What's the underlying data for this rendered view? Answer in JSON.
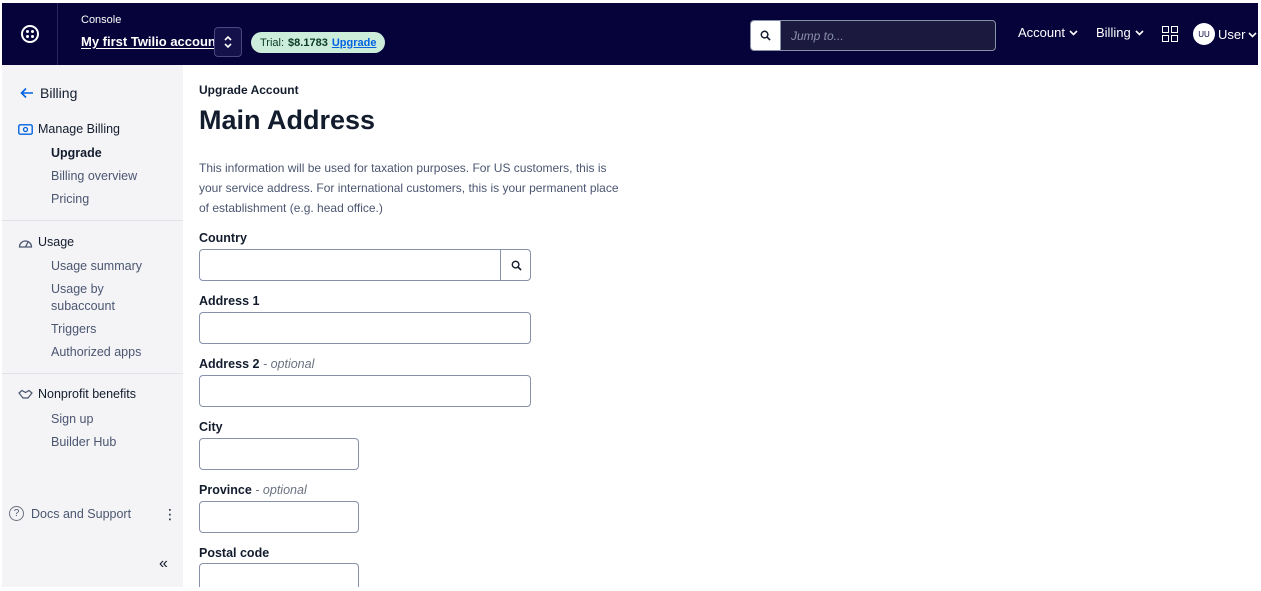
{
  "header": {
    "console_label": "Console",
    "account_name": "My first Twilio account",
    "trial_label": "Trial:",
    "trial_balance": "$8.1783",
    "upgrade_link": "Upgrade",
    "search_placeholder": "Jump to...",
    "account_menu": "Account",
    "billing_menu": "Billing",
    "avatar_initials": "UU",
    "user_label": "User"
  },
  "sidebar": {
    "back_label": "Billing",
    "sections": [
      {
        "title": "Manage Billing",
        "items": [
          "Upgrade",
          "Billing overview",
          "Pricing"
        ]
      },
      {
        "title": "Usage",
        "items": [
          "Usage summary",
          "Usage by",
          "subaccount",
          "Triggers",
          "Authorized apps"
        ]
      },
      {
        "title": "Nonprofit benefits",
        "items": [
          "Sign up",
          "Builder Hub"
        ]
      }
    ],
    "docs_label": "Docs and Support"
  },
  "main": {
    "breadcrumb": "Upgrade Account",
    "title": "Main Address",
    "description": "This information will be used for taxation purposes. For US customers, this is your service address. For international customers, this is your permanent place of establishment (e.g. head office.)",
    "fields": {
      "country": {
        "label": "Country",
        "value": ""
      },
      "address1": {
        "label": "Address 1",
        "value": ""
      },
      "address2": {
        "label": "Address 2",
        "optional": "- optional",
        "value": ""
      },
      "city": {
        "label": "City",
        "value": ""
      },
      "province": {
        "label": "Province",
        "optional": "- optional",
        "value": ""
      },
      "postal_code": {
        "label": "Postal code",
        "value": ""
      }
    }
  },
  "colors": {
    "topbar": "#06033a",
    "accent": "#0263e0",
    "trial_pill": "#cdeddb"
  }
}
